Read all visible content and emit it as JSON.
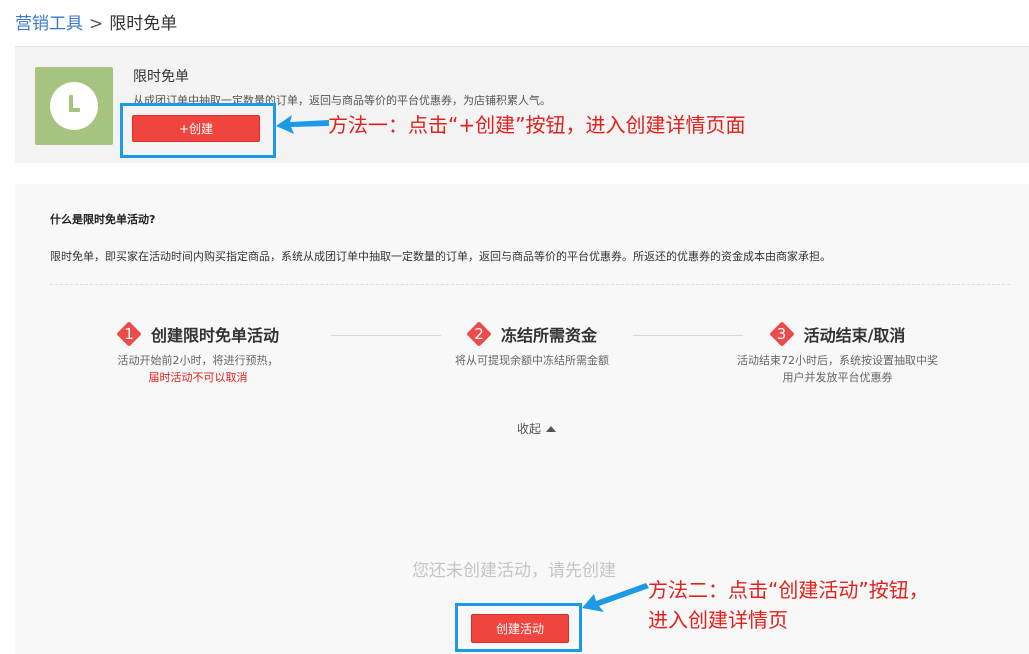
{
  "breadcrumb": {
    "root": "营销工具",
    "separator": ">",
    "current": "限时免单"
  },
  "tool": {
    "title": "限时免单",
    "description": "从成团订单中抽取一定数量的订单，返回与商品等价的平台优惠券，为店铺积累人气。",
    "create_label": "+创建",
    "icon": "clock-icon",
    "icon_color": "#a6c47f"
  },
  "info": {
    "question": "什么是限时免单活动?",
    "answer": "限时免单，即买家在活动时间内购买指定商品，系统从成团订单中抽取一定数量的订单，返回与商品等价的平台优惠券。所返还的优惠券的资金成本由商家承担。"
  },
  "steps": [
    {
      "num": "1",
      "title": "创建限时免单活动",
      "desc": "活动开始前2小时，将进行预热，",
      "warn": "届时活动不可以取消"
    },
    {
      "num": "2",
      "title": "冻结所需资金",
      "desc": "将从可提现余额中冻结所需金额"
    },
    {
      "num": "3",
      "title": "活动结束/取消",
      "desc": "活动结束72小时后，系统按设置抽取中奖",
      "desc2": "用户并发放平台优惠券"
    }
  ],
  "collapse_label": "收起",
  "empty": {
    "message": "您还未创建活动，请先创建",
    "button_label": "创建活动"
  },
  "annotations": {
    "method1": "方法一：点击“+创建”按钮，进入创建详情页面",
    "method2_line1": "方法二：点击“创建活动”按钮，",
    "method2_line2": "进入创建详情页"
  },
  "colors": {
    "accent_red": "#f0443f",
    "highlight_blue": "#1c9ae6",
    "annotation_red": "#e2211c"
  }
}
